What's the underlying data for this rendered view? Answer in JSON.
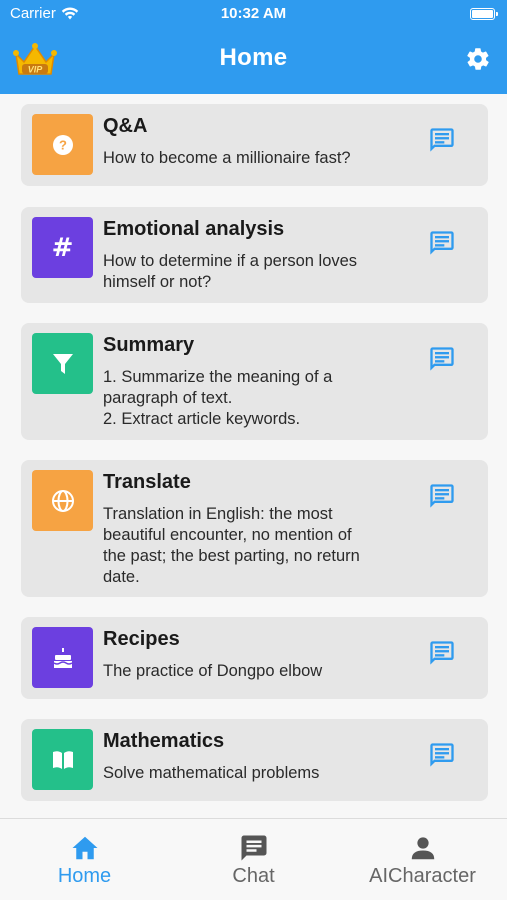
{
  "status_bar": {
    "carrier": "Carrier",
    "time": "10:32 AM"
  },
  "nav": {
    "title": "Home"
  },
  "colors": {
    "primary": "#2f9bef",
    "orange": "#f6a343",
    "purple": "#6c3fe0",
    "green": "#24c08a",
    "card_bg": "#e6e6e6"
  },
  "cards": [
    {
      "title": "Q&A",
      "description": "How to become a millionaire fast?",
      "icon": "question-icon",
      "color": "orange"
    },
    {
      "title": "Emotional analysis",
      "description": "How to determine if a person loves\nhimself or not?",
      "icon": "hashtag-icon",
      "color": "purple"
    },
    {
      "title": "Summary",
      "description": "1. Summarize the meaning of a\nparagraph of text.\n2. Extract article keywords.",
      "icon": "funnel-icon",
      "color": "green"
    },
    {
      "title": "Translate",
      "description": "Translation in English: the most\nbeautiful encounter, no mention of\nthe past; the best parting, no return\ndate.",
      "icon": "globe-icon",
      "color": "orange"
    },
    {
      "title": "Recipes",
      "description": "The practice of Dongpo elbow",
      "icon": "cake-icon",
      "color": "purple"
    },
    {
      "title": "Mathematics",
      "description": "Solve mathematical problems",
      "icon": "book-icon",
      "color": "green"
    }
  ],
  "tabs": [
    {
      "label": "Home",
      "icon": "home-icon",
      "active": true
    },
    {
      "label": "Chat",
      "icon": "chat-bubble-icon",
      "active": false
    },
    {
      "label": "AICharacter",
      "icon": "person-icon",
      "active": false
    }
  ]
}
